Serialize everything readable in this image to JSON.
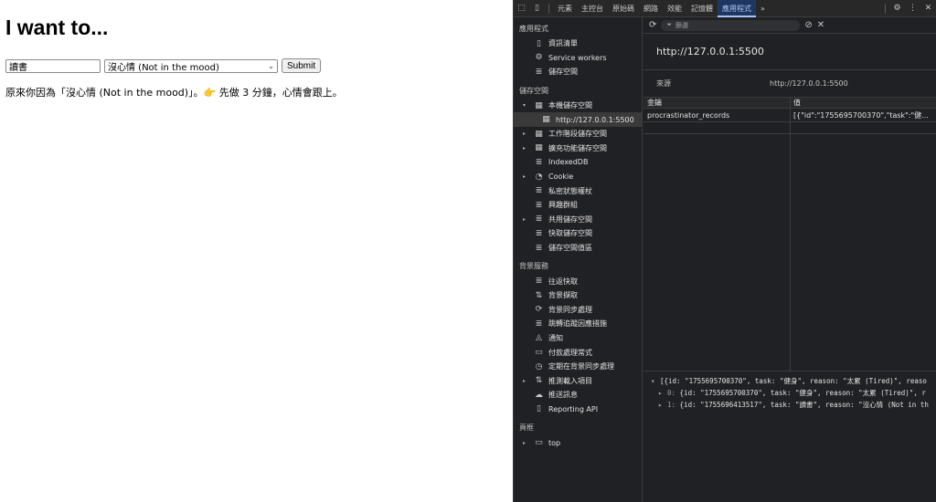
{
  "page": {
    "title": "I want to...",
    "task_value": "讀書",
    "reason_selected": "沒心情 (Not in the mood)",
    "submit_label": "Submit",
    "result_prefix": "原來你因為「沒心情 (Not in the mood)」。",
    "result_hand": "👉",
    "result_suffix": " 先做 3 分鐘，心情會跟上。"
  },
  "devtools": {
    "tabs": [
      "元素",
      "主控台",
      "原始碼",
      "網路",
      "效能",
      "記憶體",
      "應用程式"
    ],
    "active_tab": "應用程式",
    "more": "»",
    "sidebar": {
      "app_section": "應用程式",
      "app_items": [
        "資訊清單",
        "Service workers",
        "儲存空間"
      ],
      "storage_section": "儲存空間",
      "storage_items": [
        {
          "label": "本機儲存空間",
          "arrow": "▾",
          "icon": "▦"
        },
        {
          "label": "http://127.0.0.1:5500",
          "arrow": "",
          "icon": "▦"
        },
        {
          "label": "工作階段儲存空間",
          "arrow": "▸",
          "icon": "▦"
        },
        {
          "label": "擴充功能儲存空間",
          "arrow": "▸",
          "icon": "▦"
        },
        {
          "label": "IndexedDB",
          "arrow": "",
          "icon": "≣"
        },
        {
          "label": "Cookie",
          "arrow": "▸",
          "icon": "◔"
        },
        {
          "label": "私密狀態權杖",
          "arrow": "",
          "icon": "≣"
        },
        {
          "label": "興趣群組",
          "arrow": "",
          "icon": "≣"
        },
        {
          "label": "共用儲存空間",
          "arrow": "▸",
          "icon": "≣"
        },
        {
          "label": "快取儲存空間",
          "arrow": "",
          "icon": "≣"
        },
        {
          "label": "儲存空間值區",
          "arrow": "",
          "icon": "≣"
        }
      ],
      "bg_section": "背景服務",
      "bg_items": [
        {
          "label": "往返快取",
          "icon": "≣"
        },
        {
          "label": "背景擷取",
          "icon": "⇅"
        },
        {
          "label": "背景同步處理",
          "icon": "⟳"
        },
        {
          "label": "跳轉追蹤因應措施",
          "icon": "≣"
        },
        {
          "label": "通知",
          "icon": "🔔"
        },
        {
          "label": "付款處理常式",
          "icon": "▭"
        },
        {
          "label": "定期在背景同步處理",
          "icon": "◷"
        },
        {
          "label": "推測載入項目",
          "icon": "⇅"
        },
        {
          "label": "推送訊息",
          "icon": "☁"
        },
        {
          "label": "Reporting API",
          "icon": "▯"
        }
      ],
      "frames_section": "頁框",
      "frames_item": "top"
    },
    "filter_placeholder": "篩選",
    "origin": "http://127.0.0.1:5500",
    "source_label": "來源",
    "source_value": "http://127.0.0.1:5500",
    "col_key": "金鑰",
    "col_value": "值",
    "row_key": "procrastinator_records",
    "row_value": "[{\"id\":\"1755695700370\",\"task\":\"健...",
    "preview_lines": [
      {
        "tri": "▾",
        "idx": "",
        "text": "[{id: \"1755695700370\", task: \"健身\", reason: \"太累 (Tired)\", reaso"
      },
      {
        "tri": "▸",
        "idx": "0:",
        "text": " {id: \"1755695700370\", task: \"健身\", reason: \"太累 (Tired)\", r"
      },
      {
        "tri": "▸",
        "idx": "1:",
        "text": " {id: \"1755696413517\", task: \"讀書\", reason: \"沒心情 (Not in th"
      }
    ]
  }
}
